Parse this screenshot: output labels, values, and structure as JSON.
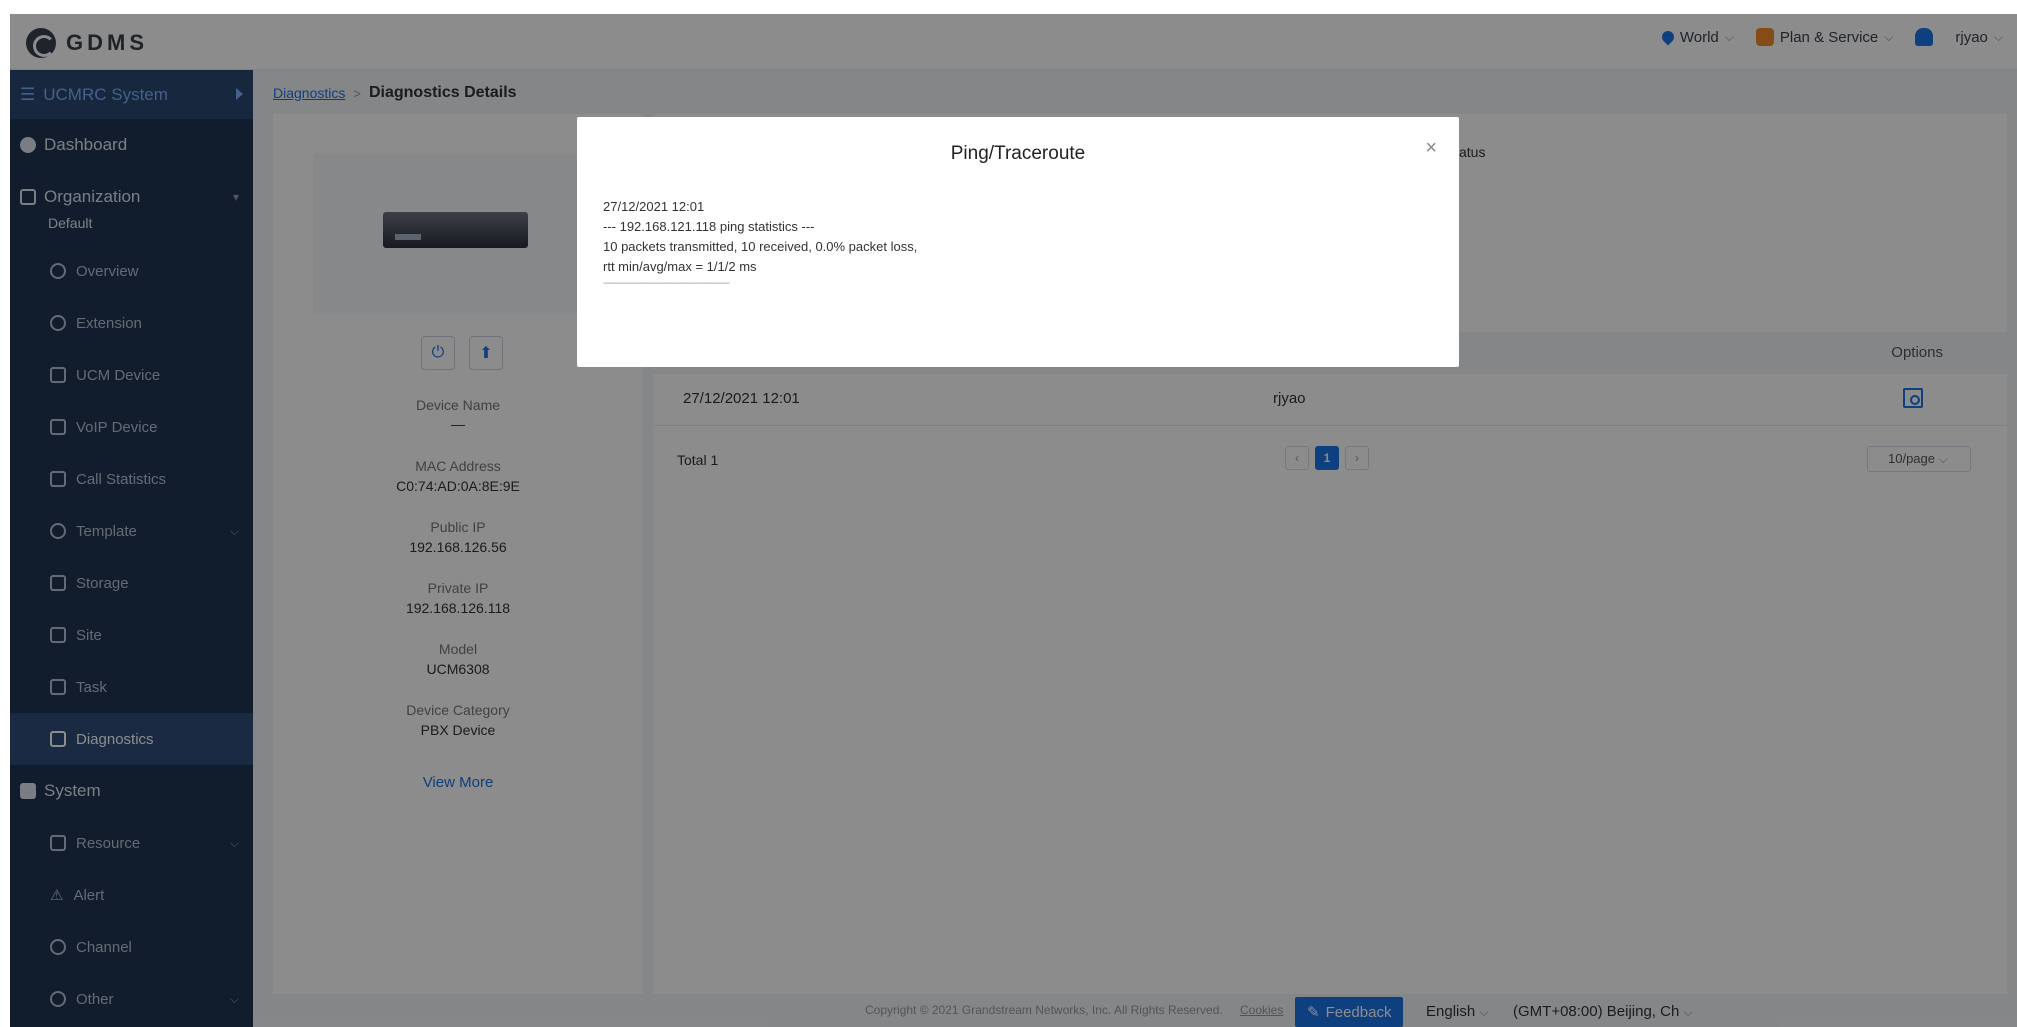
{
  "app": {
    "logo_text": "GDMS"
  },
  "topbar": {
    "region": "World",
    "plan": "Plan & Service",
    "user": "rjyao"
  },
  "sidebar": {
    "system_header": "UCMRC System",
    "dashboard": "Dashboard",
    "organization": "Organization",
    "org_name": "Default",
    "items": [
      {
        "label": "Overview",
        "icon": "pie-chart-icon"
      },
      {
        "label": "Extension",
        "icon": "user-icon"
      },
      {
        "label": "UCM Device",
        "icon": "server-icon"
      },
      {
        "label": "VoIP Device",
        "icon": "phone-icon"
      },
      {
        "label": "Call Statistics",
        "icon": "bar-chart-icon"
      },
      {
        "label": "Template",
        "icon": "gear-icon"
      },
      {
        "label": "Storage",
        "icon": "database-icon"
      },
      {
        "label": "Site",
        "icon": "site-icon"
      },
      {
        "label": "Task",
        "icon": "task-icon"
      },
      {
        "label": "Diagnostics",
        "icon": "diagnostics-icon"
      }
    ],
    "system": "System",
    "system_items": [
      {
        "label": "Resource",
        "icon": "resource-icon"
      },
      {
        "label": "Alert",
        "icon": "alert-icon"
      },
      {
        "label": "Channel",
        "icon": "channel-icon"
      },
      {
        "label": "Other",
        "icon": "more-icon"
      }
    ]
  },
  "breadcrumb": {
    "parent": "Diagnostics",
    "separator": ">",
    "current": "Diagnostics Details"
  },
  "device": {
    "labels": {
      "name": "Device Name",
      "mac": "MAC Address",
      "public_ip": "Public IP",
      "private_ip": "Private IP",
      "model": "Model",
      "category": "Device Category"
    },
    "values": {
      "name": "—",
      "mac": "C0:74:AD:0A:8E:9E",
      "public_ip": "192.168.126.56",
      "private_ip": "192.168.126.118",
      "model": "UCM6308",
      "category": "PBX Device"
    },
    "view_more": "View More"
  },
  "table": {
    "status_header_fragment": "atus",
    "options_header": "Options",
    "rows": [
      {
        "time": "27/12/2021 12:01",
        "user": "rjyao"
      }
    ],
    "total": "Total 1",
    "current_page": "1",
    "page_size": "10/page"
  },
  "footer": {
    "copyright": "Copyright © 2021 Grandstream Networks, Inc. All Rights Reserved.",
    "cookies": "Cookies",
    "feedback": "Feedback",
    "language": "English",
    "timezone": "(GMT+08:00) Beijing, Ch"
  },
  "modal": {
    "title": "Ping/Traceroute",
    "lines": [
      "27/12/2021 12:01",
      "--- 192.168.121.118 ping statistics ---",
      "10 packets transmitted, 10 received, 0.0% packet loss,",
      "rtt min/avg/max = 1/1/2 ms"
    ],
    "separator": "------------------------------------------------------"
  },
  "colors": {
    "accent": "#1a73e8",
    "sidebar_bg": "#1f3553",
    "sidebar_active": "#2e4d78"
  }
}
